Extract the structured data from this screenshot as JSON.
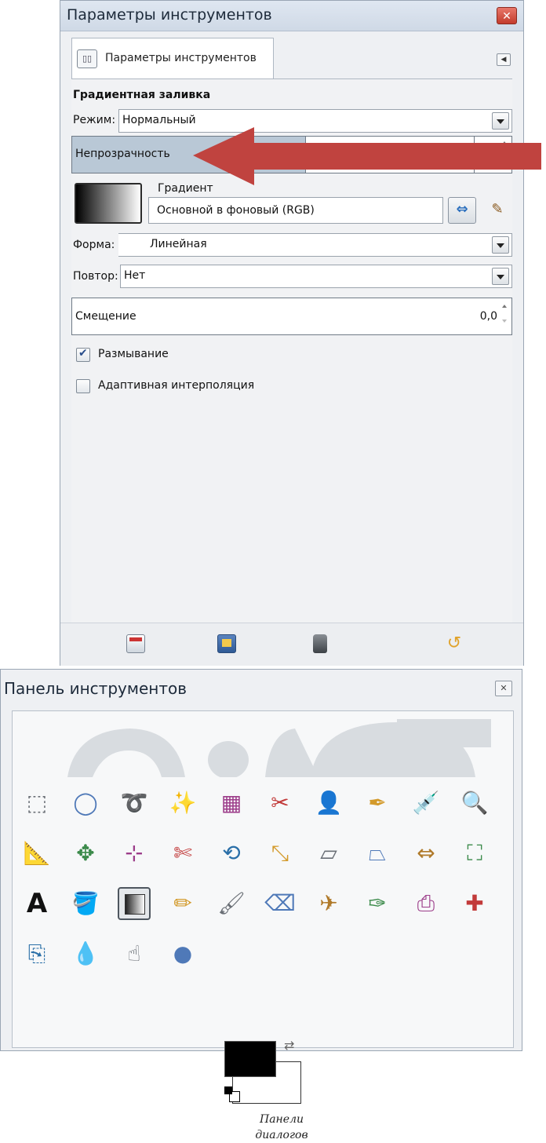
{
  "tool_options": {
    "title": "Параметры инструментов",
    "tab_label": "Параметры инструментов",
    "section_title": "Градиентная заливка",
    "mode_label": "Режим:",
    "mode_value": "Нормальный",
    "opacity_label": "Непрозрачность",
    "opacity_fraction": 0.53,
    "gradient_label": "Градиент",
    "gradient_value": "Основной в фоновый (RGB)",
    "shape_label": "Форма:",
    "shape_value": "Линейная",
    "repeat_label": "Повтор:",
    "repeat_value": "Нет",
    "offset_label": "Смещение",
    "offset_value": "0,0",
    "dither_label": "Размывание",
    "dither_checked": true,
    "adaptive_label": "Адаптивная интерполяция",
    "adaptive_checked": false
  },
  "toolbox": {
    "title": "Панель инструментов",
    "dialogs_label_line1": "Панели",
    "dialogs_label_line2": "диалогов",
    "foreground_color": "#000000",
    "background_color": "#ffffff",
    "tools": [
      {
        "name": "rect-select-icon",
        "glyph": "⬚"
      },
      {
        "name": "ellipse-select-icon",
        "glyph": "◯"
      },
      {
        "name": "free-select-icon",
        "glyph": "➰"
      },
      {
        "name": "fuzzy-select-icon",
        "glyph": "✨"
      },
      {
        "name": "color-select-icon",
        "glyph": "▦"
      },
      {
        "name": "scissors-select-icon",
        "glyph": "✂"
      },
      {
        "name": "foreground-select-icon",
        "glyph": "👤"
      },
      {
        "name": "paths-icon",
        "glyph": "✒"
      },
      {
        "name": "color-picker-icon",
        "glyph": "💉"
      },
      {
        "name": "zoom-icon",
        "glyph": "🔍"
      },
      {
        "name": "measure-icon",
        "glyph": "📐"
      },
      {
        "name": "move-icon",
        "glyph": "✥"
      },
      {
        "name": "align-icon",
        "glyph": "⊹"
      },
      {
        "name": "crop-icon",
        "glyph": "✄"
      },
      {
        "name": "rotate-icon",
        "glyph": "⟲"
      },
      {
        "name": "scale-icon",
        "glyph": "⤡"
      },
      {
        "name": "shear-icon",
        "glyph": "▱"
      },
      {
        "name": "perspective-icon",
        "glyph": "⏢"
      },
      {
        "name": "flip-icon",
        "glyph": "⇔"
      },
      {
        "name": "cage-transform-icon",
        "glyph": "⛶"
      },
      {
        "name": "text-icon",
        "glyph": "A"
      },
      {
        "name": "bucket-fill-icon",
        "glyph": "🪣"
      },
      {
        "name": "blend-icon",
        "glyph": ""
      },
      {
        "name": "pencil-icon",
        "glyph": "✏"
      },
      {
        "name": "paintbrush-icon",
        "glyph": "🖌"
      },
      {
        "name": "eraser-icon",
        "glyph": "⌫"
      },
      {
        "name": "airbrush-icon",
        "glyph": "✈"
      },
      {
        "name": "ink-icon",
        "glyph": "✑"
      },
      {
        "name": "clone-icon",
        "glyph": "⎙"
      },
      {
        "name": "heal-icon",
        "glyph": "✚"
      },
      {
        "name": "perspective-clone-icon",
        "glyph": "⎘"
      },
      {
        "name": "blur-sharpen-icon",
        "glyph": "💧"
      },
      {
        "name": "smudge-icon",
        "glyph": "☝"
      },
      {
        "name": "dodge-burn-icon",
        "glyph": "●"
      }
    ]
  },
  "colors": {
    "annotation_arrow": "#c0433f",
    "opacity_fill": "#b9c8d6"
  }
}
